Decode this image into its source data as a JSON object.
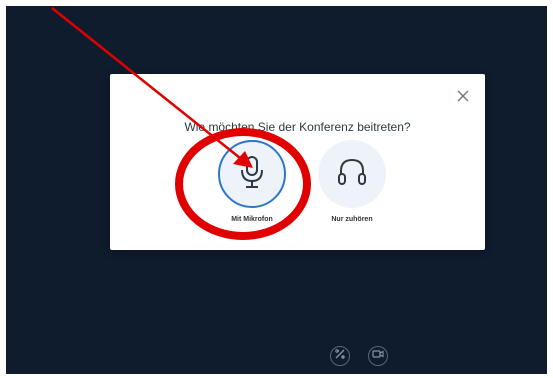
{
  "dialog": {
    "title": "Wie möchten Sie der Konferenz beitreten?",
    "options": [
      {
        "label": "Mit Mikrofon",
        "icon": "microphone-icon",
        "selected": true
      },
      {
        "label": "Nur zuhören",
        "icon": "headphones-icon",
        "selected": false
      }
    ],
    "close_icon": "close-icon"
  },
  "toolbar": {
    "buttons": [
      {
        "icon": "screen-share-icon"
      },
      {
        "icon": "video-camera-icon"
      }
    ]
  },
  "annotation": {
    "color": "#e00000"
  }
}
